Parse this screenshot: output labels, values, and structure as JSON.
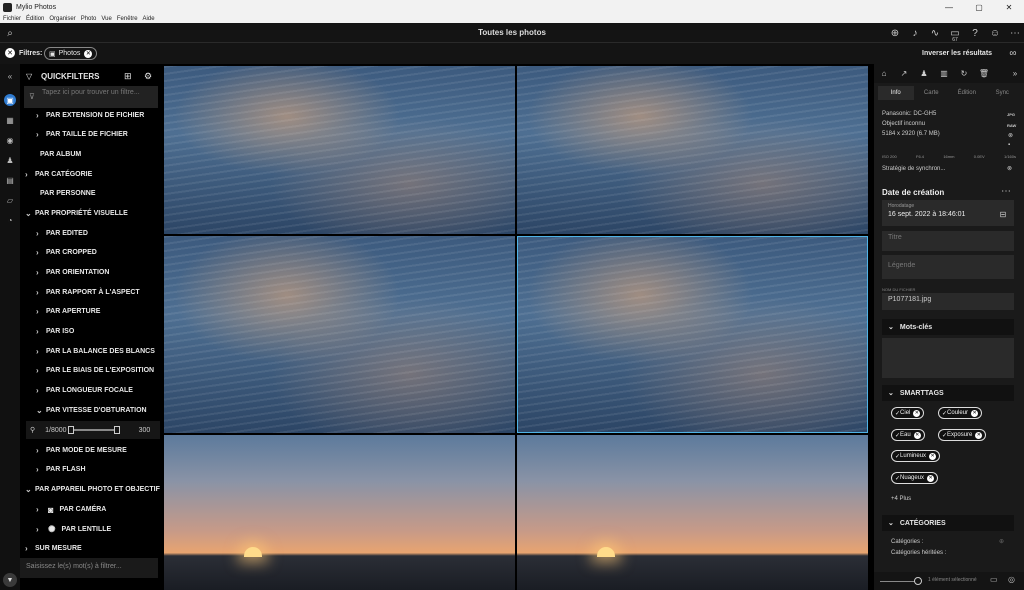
{
  "window": {
    "title": "Mylio Photos",
    "min": "—",
    "max": "▢",
    "close": "✕"
  },
  "menu": [
    "Fichier",
    "Édition",
    "Organiser",
    "Photo",
    "Vue",
    "Fenêtre",
    "Aide"
  ],
  "appbar": {
    "title": "Toutes les photos",
    "badge": "67"
  },
  "filters": {
    "label": "Filtres:",
    "chip": "Photos",
    "invert": "Inverser les résultats"
  },
  "quickfilters": {
    "title": "QUICKFILTERS",
    "search_placeholder": "Tapez ici pour trouver un filtre...",
    "nodes": [
      "PAR EXTENSION DE FICHIER",
      "PAR TAILLE DE FICHIER",
      "PAR ALBUM",
      "PAR CATÉGORIE",
      "PAR PERSONNE",
      "PAR PROPRIÉTÉ VISUELLE",
      "PAR EDITED",
      "PAR CROPPED",
      "PAR ORIENTATION",
      "PAR RAPPORT À L'ASPECT",
      "PAR APERTURE",
      "PAR ISO",
      "PAR LA BALANCE DES BLANCS",
      "PAR LE BIAIS DE L'EXPOSITION",
      "PAR LONGUEUR FOCALE",
      "PAR VITESSE D'OBTURATION",
      "PAR MODE DE MESURE",
      "PAR FLASH",
      "PAR APPAREIL PHOTO ET OBJECTIF",
      "PAR CAMÉRA",
      "PAR LENTILLE",
      "SUR MESURE"
    ],
    "slider_min": "1/8000",
    "slider_max": "300",
    "footer_placeholder": "Saisissez le(s) mot(s) à filtrer..."
  },
  "info": {
    "tabs": [
      "Info",
      "Carte",
      "Édition",
      "Sync"
    ],
    "camera": "Panasonic: DC-GH5",
    "lens": "Objectif inconnu",
    "dims": "5184 x 2920 (6.7 MB)",
    "fmt1": "JPG",
    "fmt2": "RAW",
    "exif": [
      "ISO 200",
      "F6.4",
      "16mm",
      "0.0EV",
      "1/160s"
    ],
    "sync": "Stratégie de synchron...",
    "date_title": "Date de création",
    "date_label": "Horodatage",
    "date_value": "16 sept. 2022 à 18:46:01",
    "title_ph": "Titre",
    "caption_ph": "Légende",
    "filename_label": "NOM DU FICHIER",
    "filename": "P1077181.jpg",
    "keywords": "Mots-clés",
    "smarttags": "SMARTTAGS",
    "tags": [
      "Ciel",
      "Couleur",
      "Eau",
      "Exposure",
      "Lumineux",
      "Nuageux"
    ],
    "more": "+4 Plus",
    "categories": "CATÉGORIES",
    "cat1": "Catégories :",
    "cat2": "Catégories héritées :",
    "status": "1 élément sélectionné"
  }
}
